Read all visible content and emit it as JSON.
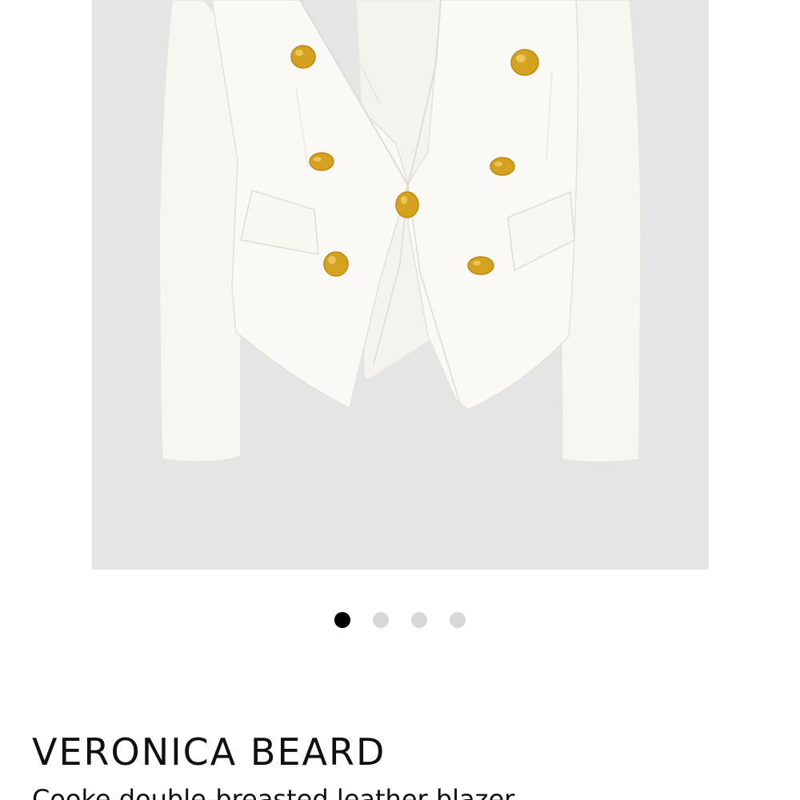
{
  "product": {
    "brand": "VERONICA BEARD",
    "name": "Cooke double-breasted leather blazer"
  },
  "gallery": {
    "image_count": 4,
    "active_index": 0,
    "background_color": "#e5e5e5",
    "garment_color": "#faf9f5",
    "button_color": "#d4a21e"
  }
}
